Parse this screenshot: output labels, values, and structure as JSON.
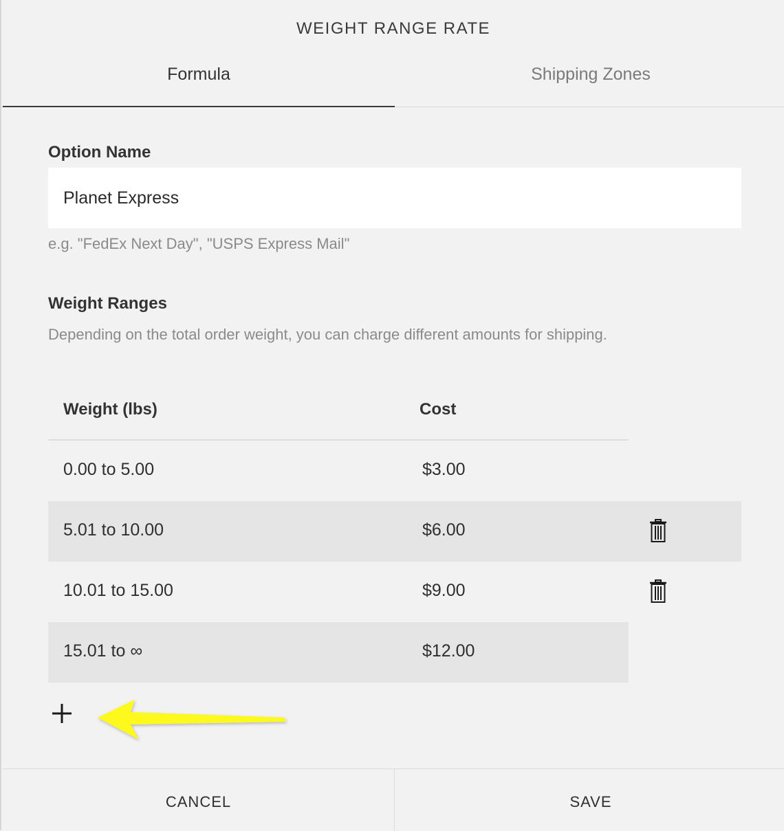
{
  "dialog": {
    "title": "WEIGHT RANGE RATE",
    "tabs": [
      {
        "label": "Formula",
        "active": true
      },
      {
        "label": "Shipping Zones",
        "active": false
      }
    ]
  },
  "option_name": {
    "label": "Option Name",
    "value": "Planet Express",
    "help": "e.g. \"FedEx Next Day\", \"USPS Express Mail\""
  },
  "weight_ranges": {
    "label": "Weight Ranges",
    "description": "Depending on the total order weight, you can charge different amounts for shipping.",
    "columns": [
      "Weight (lbs)",
      "Cost"
    ],
    "rows": [
      {
        "from": "0.00",
        "sep": "to",
        "to": "5.00",
        "cost": "$3.00",
        "deletable": false
      },
      {
        "from": "5.01",
        "sep": "to",
        "to": "10.00",
        "cost": "$6.00",
        "deletable": true
      },
      {
        "from": "10.01",
        "sep": "to",
        "to": "15.00",
        "cost": "$9.00",
        "deletable": true
      },
      {
        "from": "15.01",
        "sep": "to",
        "to": "∞",
        "cost": "$12.00",
        "deletable": false
      }
    ],
    "add_icon": "plus-icon"
  },
  "annotation": {
    "icon": "arrow-left-icon",
    "color": "#ffff00"
  },
  "footer": {
    "cancel_label": "CANCEL",
    "save_label": "SAVE"
  }
}
